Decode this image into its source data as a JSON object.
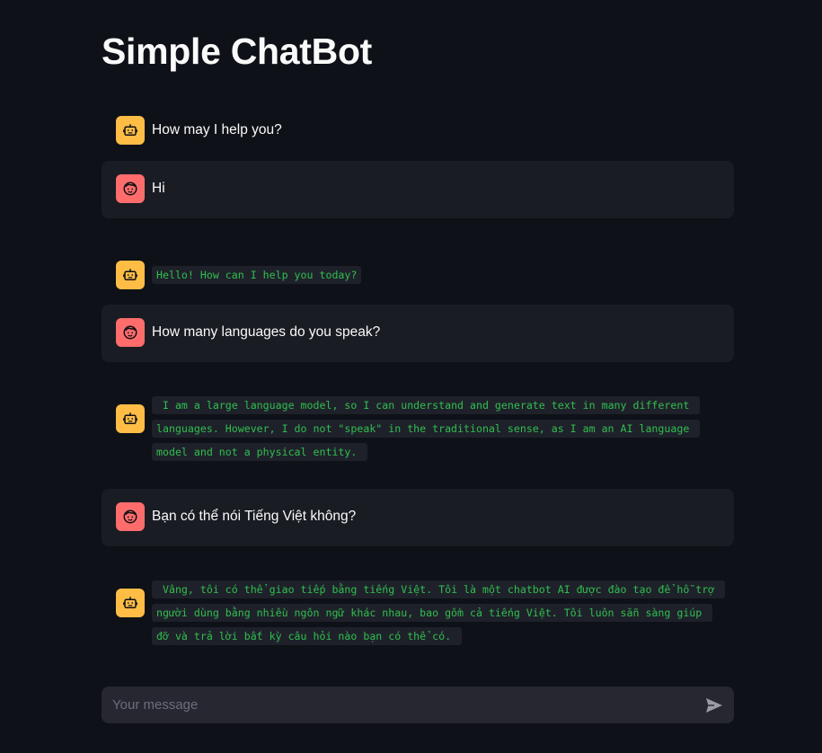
{
  "app": {
    "title": "Simple ChatBot"
  },
  "messages": [
    {
      "role": "assistant",
      "avatar_icon": "robot-icon",
      "text": "How may I help you?",
      "format": "plain"
    },
    {
      "role": "user",
      "avatar_icon": "face-icon",
      "text": "Hi",
      "format": "plain"
    },
    {
      "role": "assistant",
      "avatar_icon": "robot-icon",
      "text": "Hello! How can I help you today?",
      "format": "code"
    },
    {
      "role": "user",
      "avatar_icon": "face-icon",
      "text": "How many languages do you speak?",
      "format": "plain"
    },
    {
      "role": "assistant",
      "avatar_icon": "robot-icon",
      "text": " I am a large language model, so I can understand and generate text in many different languages. However, I do not \"speak\" in the traditional sense, as I am an AI language model and not a physical entity. ",
      "format": "code"
    },
    {
      "role": "user",
      "avatar_icon": "face-icon",
      "text": "Bạn có thể nói Tiếng Việt không?",
      "format": "plain"
    },
    {
      "role": "assistant",
      "avatar_icon": "robot-icon",
      "text": " Vâng, tôi có thể giao tiếp bằng tiếng Việt. Tôi là một chatbot AI được đào tạo để hỗ trợ người dùng bằng nhiều ngôn ngữ khác nhau, bao gồm cả tiếng Việt. Tôi luôn sẵn sàng giúp đỡ và trả lời bất kỳ câu hỏi nào bạn có thể có. ",
      "format": "code"
    }
  ],
  "chat_input": {
    "placeholder": "Your message",
    "value": "",
    "send_icon": "send-icon"
  },
  "colors": {
    "background": "#0e1117",
    "user_bubble": "#1a1c24",
    "bot_avatar": "#ffbd45",
    "user_avatar": "#ff6c6c",
    "code_text": "#2fbf4f",
    "input_bg": "#262730"
  }
}
